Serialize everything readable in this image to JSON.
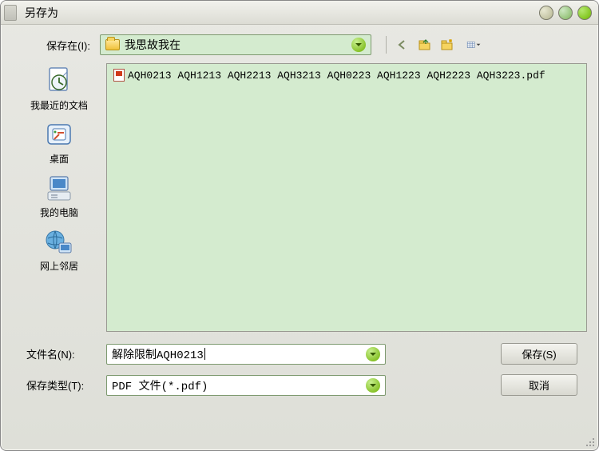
{
  "window_title": "另存为",
  "location": {
    "label": "保存在(I):",
    "folder_name": "我思故我在"
  },
  "sidebar": {
    "items": [
      {
        "label": "我最近的文档"
      },
      {
        "label": "桌面"
      },
      {
        "label": "我的电脑"
      },
      {
        "label": "网上邻居"
      }
    ]
  },
  "file_listing": {
    "files": [
      {
        "name": "AQH0213 AQH1213 AQH2213 AQH3213 AQH0223 AQH1223 AQH2223 AQH3223.pdf"
      }
    ]
  },
  "filename_label": "文件名(N):",
  "filename_value": "解除限制AQH0213",
  "filetype_label": "保存类型(T):",
  "filetype_value": "PDF 文件(*.pdf)",
  "save_button": "保存(S)",
  "cancel_button": "取消"
}
